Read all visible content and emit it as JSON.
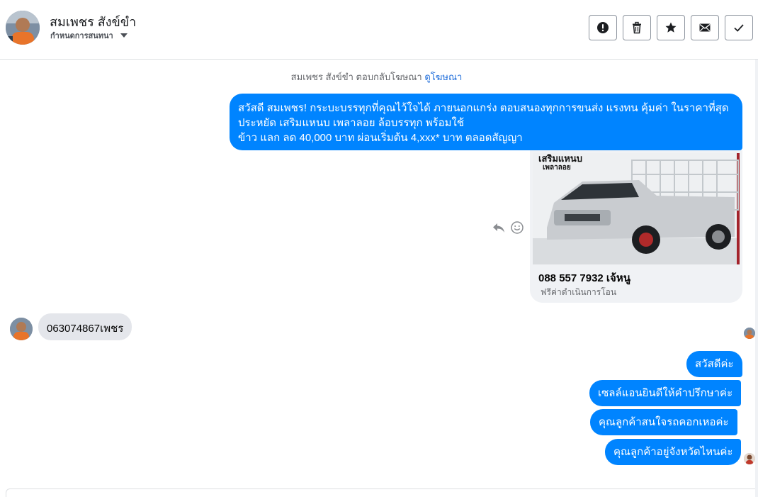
{
  "header": {
    "name": "สมเพชร สังข์ขำ",
    "subtitle": "กำหนดการสนทนา",
    "actions": [
      "report",
      "delete",
      "star",
      "mark-unread",
      "done"
    ]
  },
  "conversation": {
    "notice_prefix": "สมเพชร สังข์ขำ ตอบกลับโฆษณา",
    "notice_link": "ดูโฆษณา",
    "intro_lines": [
      "สวัสดี สมเพชร! กระบะบรรทุกที่คุณไว้ใจได้ ภายนอกแกร่ง ตอบสนองทุกการขนส่ง แรงทน คุ้มค่า ในราคาที่สุด",
      "ประหยัด เสริมแหนบ เพลาลอย ล้อบรรทุก พร้อมใช้",
      "ข้าว แลก ลด 40,000 บาท ผ่อนเริ่มต้น 4,xxx* บาท ตลอดสัญญา"
    ],
    "ad": {
      "image_text_1": "เสริมแหนบ",
      "image_text_2": "เพลาลอย",
      "title": "088 557 7932 เจ้หนู",
      "description": "ฟรีค่าดำเนินการโอน"
    },
    "incoming": "063074867เพชร",
    "outgoing": [
      "สวัสดีค่ะ",
      "เซลล์แอนยินดีให้คำปรึกษาค่ะ",
      "คุณลูกค้าสนใจรถคอกเหอค่ะ",
      "คุณลูกค้าอยู่จังหวัดไหนค่ะ"
    ]
  },
  "colors": {
    "accent": "#0084ff",
    "incoming_bubble": "#e4e6eb",
    "link": "#216fdb"
  }
}
